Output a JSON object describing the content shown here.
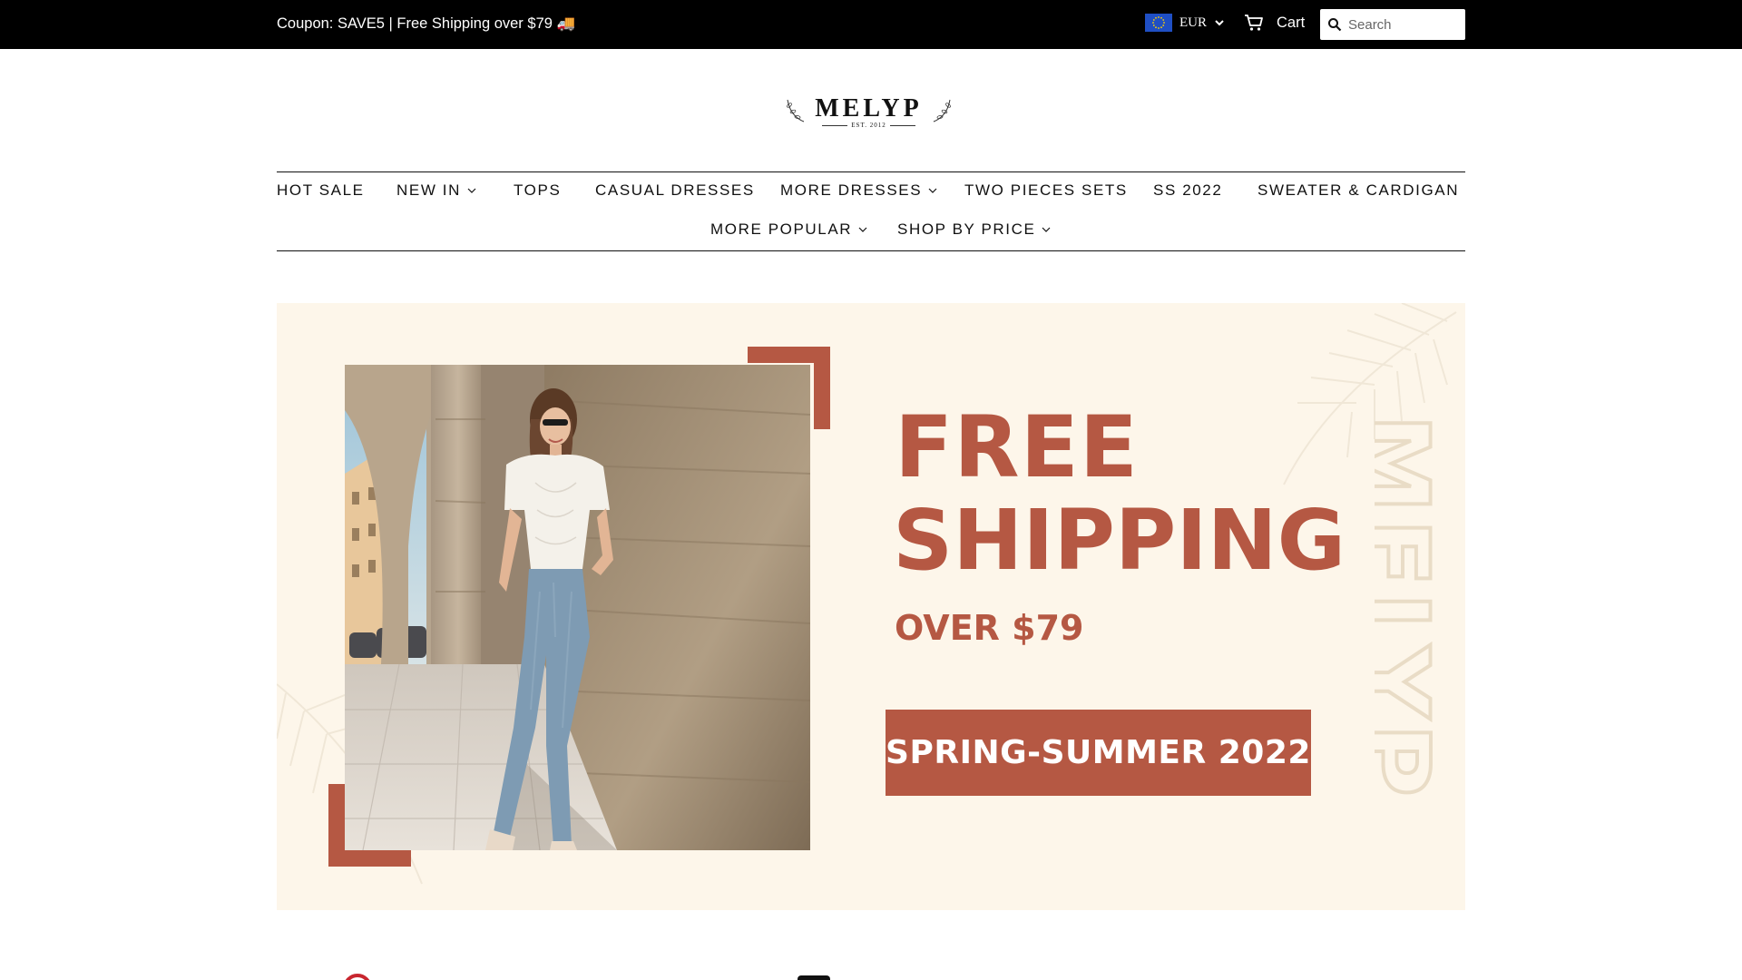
{
  "topbar": {
    "coupon_text": "Coupon: SAVE5 | Free Shipping over $79 🚚",
    "currency": {
      "code": "EUR",
      "flag_icon": "eu-flag-icon",
      "dropdown_icon": "chevron-down-icon"
    },
    "cart": {
      "label": "Cart",
      "icon": "cart-icon"
    },
    "search": {
      "placeholder": "Search",
      "value": "",
      "icon": "search-icon"
    }
  },
  "logo": {
    "name": "MELYP",
    "tagline": "EST. 2012"
  },
  "nav": {
    "row1": [
      {
        "label": "HOT SALE",
        "has_dropdown": false
      },
      {
        "label": "NEW IN",
        "has_dropdown": true
      },
      {
        "label": "TOPS",
        "has_dropdown": false
      },
      {
        "label": "CASUAL DRESSES",
        "has_dropdown": false
      },
      {
        "label": "MORE DRESSES",
        "has_dropdown": true
      },
      {
        "label": "TWO PIECES SETS",
        "has_dropdown": false
      },
      {
        "label": "SS 2022",
        "has_dropdown": false
      },
      {
        "label": "SWEATER & CARDIGAN",
        "has_dropdown": false
      }
    ],
    "row2": [
      {
        "label": "MORE POPULAR",
        "has_dropdown": true
      },
      {
        "label": "SHOP BY PRICE",
        "has_dropdown": true
      }
    ]
  },
  "hero": {
    "headline_1": "FREE",
    "headline_2": "SHIPPING",
    "subline": "OVER $79",
    "button_label": "SPRING-SUMMER 2022",
    "vertical_brand": "MELYP",
    "colors": {
      "accent": "#b55843",
      "background": "#fdf6ea"
    }
  }
}
